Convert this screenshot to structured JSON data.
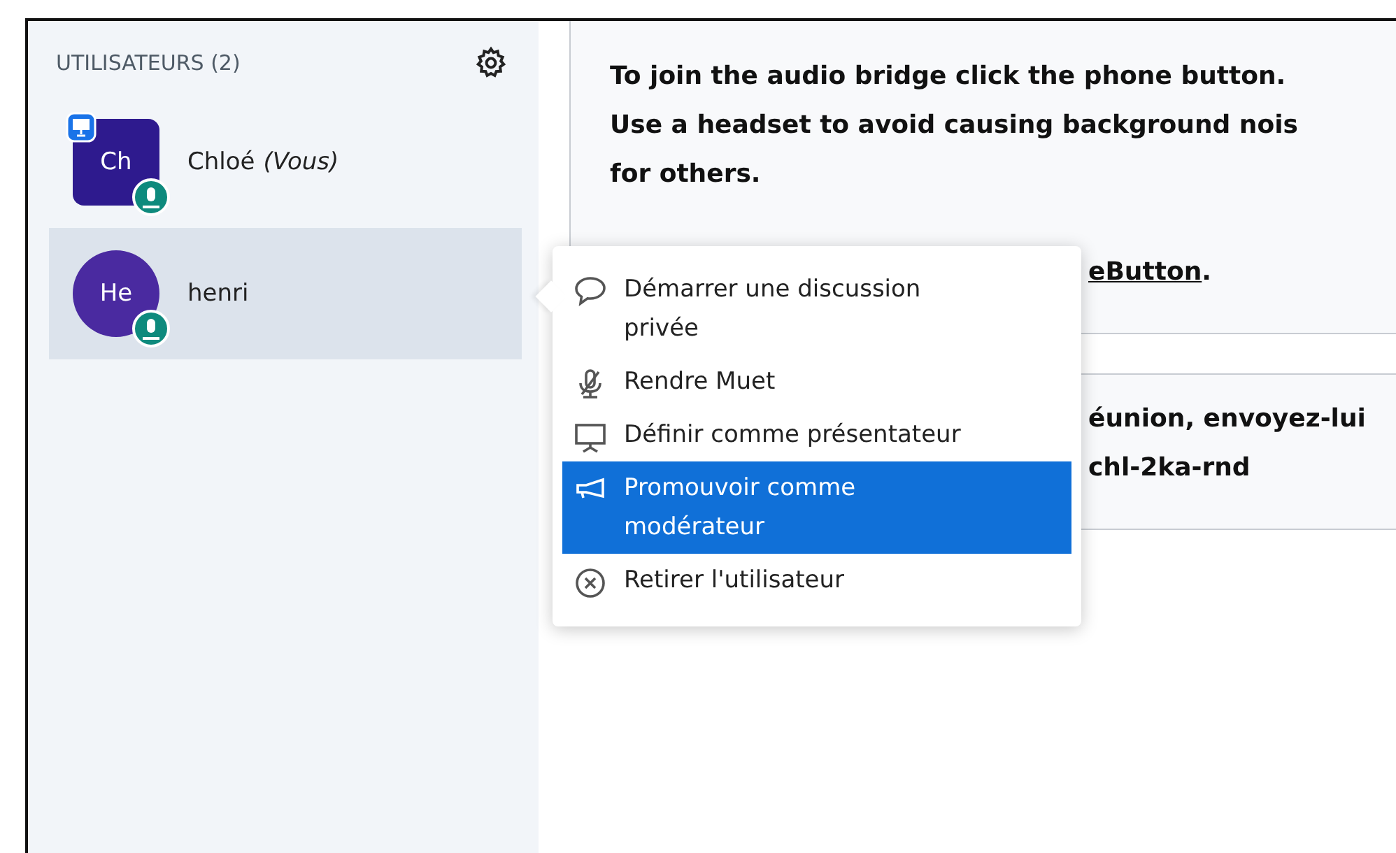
{
  "sidebar": {
    "title": "UTILISATEURS (2)",
    "users": [
      {
        "initials": "Ch",
        "name": "Chloé",
        "suffix": "(Vous)",
        "selected": false,
        "moderator": true,
        "presenter": true
      },
      {
        "initials": "He",
        "name": "henri",
        "selected": true,
        "moderator": false,
        "presenter": false
      }
    ]
  },
  "messages": [
    {
      "lines": [
        "To join the audio bridge click the phone button.",
        "Use a headset to avoid causing background nois",
        "for others."
      ],
      "link": "eButton",
      "after": "."
    },
    {
      "lines": [
        "éunion, envoyez-lui",
        "chl-2ka-rnd"
      ]
    }
  ],
  "context_menu": {
    "items": [
      {
        "kind": "chat",
        "label": "Démarrer une discussion privée",
        "selected": false
      },
      {
        "kind": "mute",
        "label": "Rendre Muet",
        "selected": false
      },
      {
        "kind": "presenter",
        "label": "Définir comme présentateur",
        "selected": false
      },
      {
        "kind": "promote",
        "label": "Promouvoir comme modérateur",
        "selected": true
      },
      {
        "kind": "remove",
        "label": "Retirer l'utilisateur",
        "selected": false
      }
    ]
  }
}
